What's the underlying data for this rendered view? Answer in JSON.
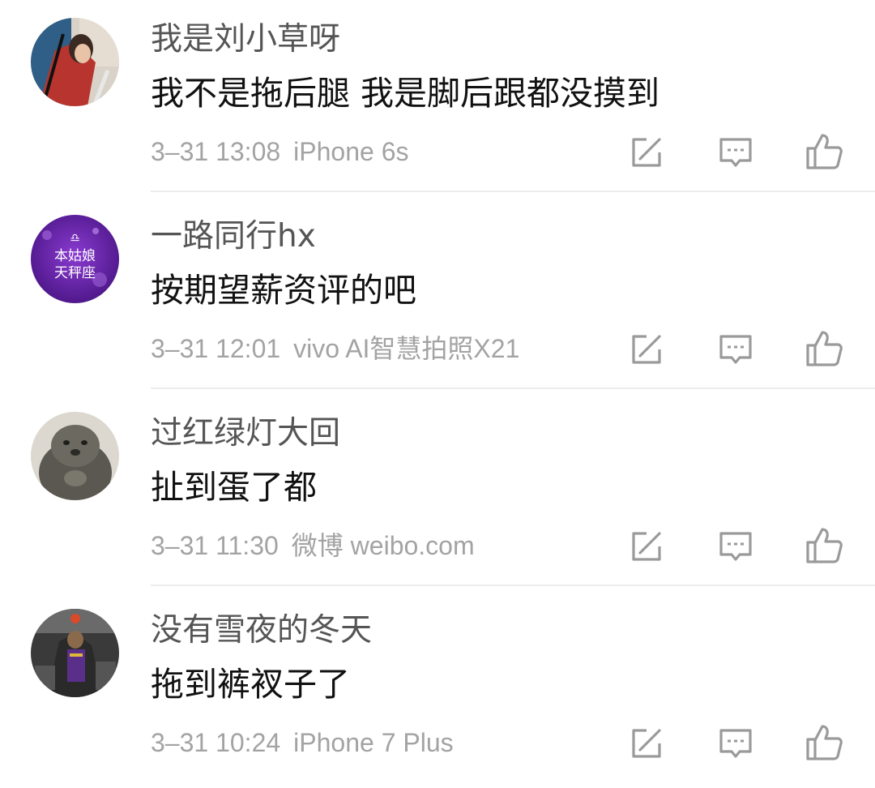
{
  "comments": [
    {
      "username": "我是刘小草呀",
      "text": "我不是拖后腿 我是脚后跟都没摸到",
      "time": "3–31 13:08",
      "device": "iPhone 6s"
    },
    {
      "username": "一路同行hx",
      "text": "按期望薪资评的吧",
      "time": "3–31 12:01",
      "device": "vivo AI智慧拍照X21",
      "avatar_text_line1": "本姑娘",
      "avatar_text_line2": "天秤座",
      "avatar_symbol": "♎"
    },
    {
      "username": "过红绿灯大回",
      "text": "扯到蛋了都",
      "time": "3–31 11:30",
      "device": "微博 weibo.com"
    },
    {
      "username": "没有雪夜的冬天",
      "text": "拖到裤衩子了",
      "time": "3–31 10:24",
      "device": "iPhone 7 Plus"
    }
  ],
  "icons": {
    "repost": "edit-icon",
    "reply": "comment-icon",
    "like": "thumbs-up-icon"
  },
  "colors": {
    "username": "#555555",
    "text": "#111111",
    "meta": "#a3a3a3",
    "icon": "#9a9a9a",
    "divider": "#ececec"
  }
}
